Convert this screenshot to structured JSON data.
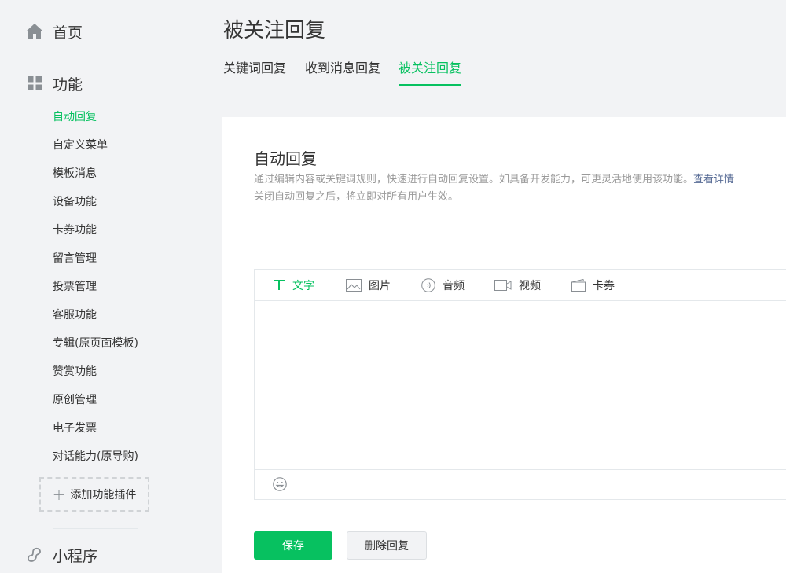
{
  "sidebar": {
    "home_label": "首页",
    "functions_label": "功能",
    "items": [
      {
        "label": "自动回复"
      },
      {
        "label": "自定义菜单"
      },
      {
        "label": "模板消息"
      },
      {
        "label": "设备功能"
      },
      {
        "label": "卡券功能"
      },
      {
        "label": "留言管理"
      },
      {
        "label": "投票管理"
      },
      {
        "label": "客服功能"
      },
      {
        "label": "专辑(原页面模板)"
      },
      {
        "label": "赞赏功能"
      },
      {
        "label": "原创管理"
      },
      {
        "label": "电子发票"
      },
      {
        "label": "对话能力(原导购)"
      }
    ],
    "add_plugin_label": "添加功能插件",
    "miniprogram_label": "小程序"
  },
  "header": {
    "title": "被关注回复",
    "tabs": [
      {
        "label": "关键词回复"
      },
      {
        "label": "收到消息回复"
      },
      {
        "label": "被关注回复"
      }
    ]
  },
  "main": {
    "section_title": "自动回复",
    "description_line1": "通过编辑内容或关键词规则，快速进行自动回复设置。如具备开发能力，可更灵活地使用该功能。",
    "details_link": "查看详情",
    "description_line2": "关闭自动回复之后，将立即对所有用户生效。",
    "editor_tabs": [
      {
        "label": "文字",
        "icon": "text-icon"
      },
      {
        "label": "图片",
        "icon": "image-icon"
      },
      {
        "label": "音频",
        "icon": "audio-icon"
      },
      {
        "label": "视频",
        "icon": "video-icon"
      },
      {
        "label": "卡券",
        "icon": "coupon-icon"
      }
    ],
    "save_label": "保存",
    "delete_label": "删除回复"
  },
  "colors": {
    "accent": "#07c160",
    "link": "#576b95",
    "background": "#f2f3f5"
  }
}
